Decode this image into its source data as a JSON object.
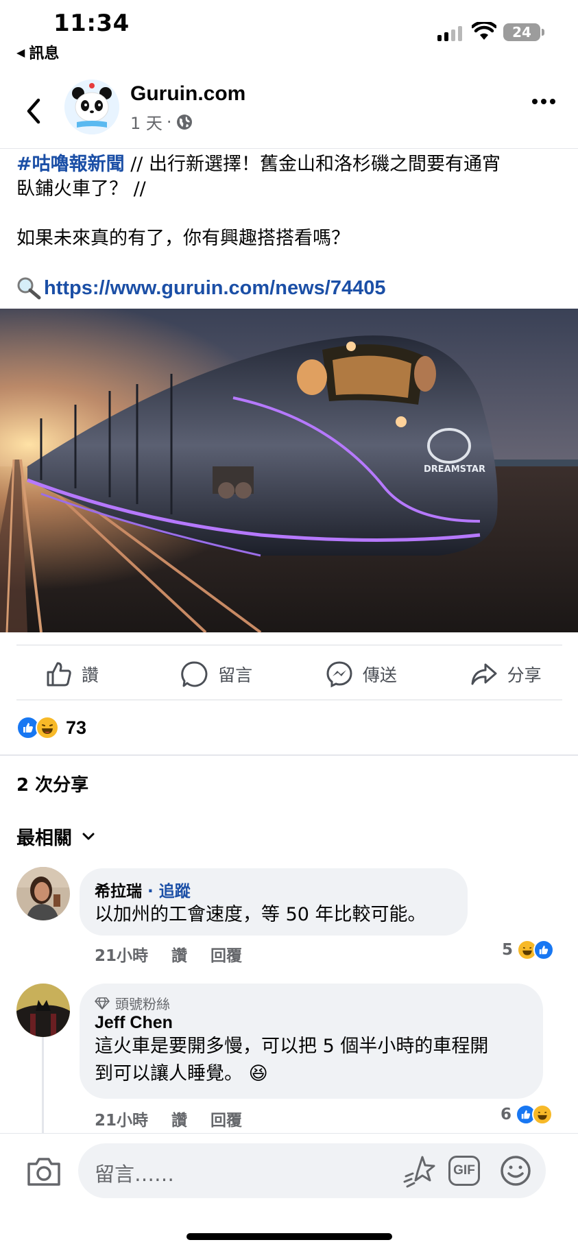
{
  "status": {
    "time": "11:34",
    "back_label": "訊息",
    "battery": "24"
  },
  "post": {
    "page_name": "Guruin.com",
    "age": "1 天",
    "hashtag": "#咕嚕報新聞",
    "text_line1": " // 出行新選擇！舊金山和洛杉磯之間要有通宵",
    "text_line2": "臥鋪火車了？ //",
    "text_line3": "如果未來真的有了，你有興趣搭搭看嗎？",
    "link": "https://www.guruin.com/news/74405",
    "image_text": "DREAMSTAR"
  },
  "actions": {
    "like": "讚",
    "comment": "留言",
    "send": "傳送",
    "share": "分享"
  },
  "reactions": {
    "count": "73"
  },
  "shares_label": "2 次分享",
  "sort_label": "最相關",
  "comments": [
    {
      "name": "希拉瑞",
      "follow": "· 追蹤",
      "text": "以加州的工會速度，等 50 年比較可能。",
      "time": "21小時",
      "like": "讚",
      "reply": "回覆",
      "reaction_count": "5"
    },
    {
      "badge": "頭號粉絲",
      "name": "Jeff Chen",
      "text_line1": "這火車是要開多慢，可以把 5 個半小時的車程開",
      "text_line2": "到可以讓人睡覺。 😆",
      "time": "21小時",
      "like": "讚",
      "reply": "回覆",
      "reaction_count": "6"
    }
  ],
  "composer": {
    "placeholder": "留言……",
    "gif_label": "GIF"
  },
  "colors": {
    "link_blue": "#1b4fa6",
    "like_blue": "#1877f2",
    "haha_yellow": "#f7b928",
    "secondary_text": "#65676b",
    "bubble_bg": "#f0f2f5"
  }
}
